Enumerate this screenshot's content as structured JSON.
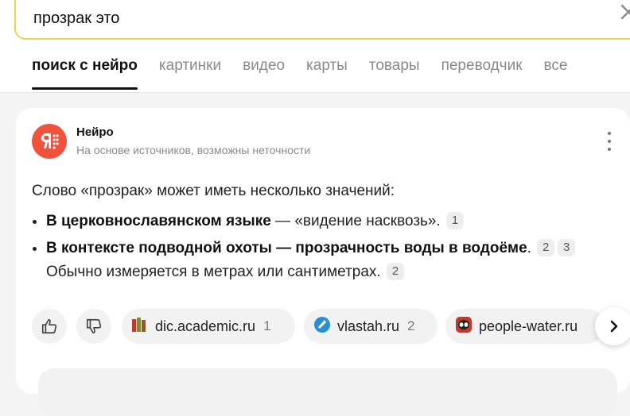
{
  "search": {
    "query": "прозрак это",
    "clear_icon": "close-icon"
  },
  "tabs": [
    {
      "label": "поиск с нейро",
      "active": true
    },
    {
      "label": "картинки",
      "active": false
    },
    {
      "label": "видео",
      "active": false
    },
    {
      "label": "карты",
      "active": false
    },
    {
      "label": "товары",
      "active": false
    },
    {
      "label": "переводчик",
      "active": false
    },
    {
      "label": "все",
      "active": false
    }
  ],
  "neuro": {
    "brand": "Нейро",
    "disclaimer": "На основе источников, возможны неточности",
    "avatar_color": "#f0523c",
    "menu_icon": "more-vertical-icon"
  },
  "answer": {
    "intro": "Слово «прозрак» может иметь несколько значений:",
    "items": [
      {
        "bold": "В церковнославянском языке",
        "text": " — «видение насквозь».",
        "refs": [
          "1"
        ]
      },
      {
        "bold": "В контексте подводной охоты — прозрачность воды в водоёме",
        "text": ".",
        "refs": [
          "2",
          "3"
        ],
        "tail": " Обычно измеряется в метрах или сантиметрах.",
        "tail_refs": [
          "2"
        ]
      }
    ]
  },
  "feedback": {
    "like_icon": "thumbs-up-icon",
    "dislike_icon": "thumbs-down-icon"
  },
  "sources": [
    {
      "domain": "dic.academic.ru",
      "num": "1",
      "icon": "books-icon"
    },
    {
      "domain": "vlastah.ru",
      "num": "2",
      "icon": "blue-circle-icon"
    },
    {
      "domain": "people-water.ru",
      "num": "",
      "icon": "diver-mask-icon"
    }
  ],
  "next_icon": "chevron-right-icon",
  "colors": {
    "accent_yellow": "#f3d153",
    "neuro_red": "#f0523c",
    "muted_text": "#8a8a8a"
  }
}
